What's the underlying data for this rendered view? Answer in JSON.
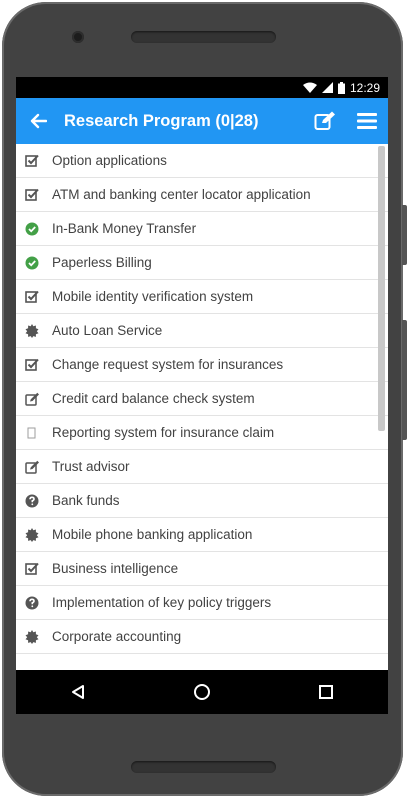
{
  "device": {
    "status_time": "12:29"
  },
  "appbar": {
    "title": "Research Program (0|28)",
    "back_icon": "arrow-left-icon",
    "edit_icon": "edit-icon",
    "menu_icon": "hamburger-menu-icon",
    "color": "#2196f3"
  },
  "items": [
    {
      "label": "Option applications",
      "icon": "checkbox-checked"
    },
    {
      "label": "ATM and banking center locator application",
      "icon": "checkbox-checked"
    },
    {
      "label": "In-Bank Money Transfer",
      "icon": "check-circle-green"
    },
    {
      "label": "Paperless Billing",
      "icon": "check-circle-green"
    },
    {
      "label": "Mobile identity verification system",
      "icon": "checkbox-checked"
    },
    {
      "label": "Auto Loan Service",
      "icon": "gear-burst"
    },
    {
      "label": "Change request system for insurances",
      "icon": "checkbox-checked"
    },
    {
      "label": "Credit card balance check system",
      "icon": "edit-square"
    },
    {
      "label": "Reporting system for insurance claim",
      "icon": "empty-square"
    },
    {
      "label": "Trust advisor",
      "icon": "edit-square"
    },
    {
      "label": "Bank funds",
      "icon": "question-circle"
    },
    {
      "label": "Mobile phone banking application",
      "icon": "gear-burst"
    },
    {
      "label": "Business intelligence",
      "icon": "checkbox-checked"
    },
    {
      "label": "Implementation of key policy triggers",
      "icon": "question-circle"
    },
    {
      "label": "Corporate accounting",
      "icon": "gear-burst"
    }
  ],
  "navbar": {
    "back_icon": "nav-back-triangle-icon",
    "home_icon": "nav-home-circle-icon",
    "recents_icon": "nav-recents-square-icon"
  },
  "colors": {
    "green_check": "#43a047",
    "icon_gray": "#555555"
  }
}
